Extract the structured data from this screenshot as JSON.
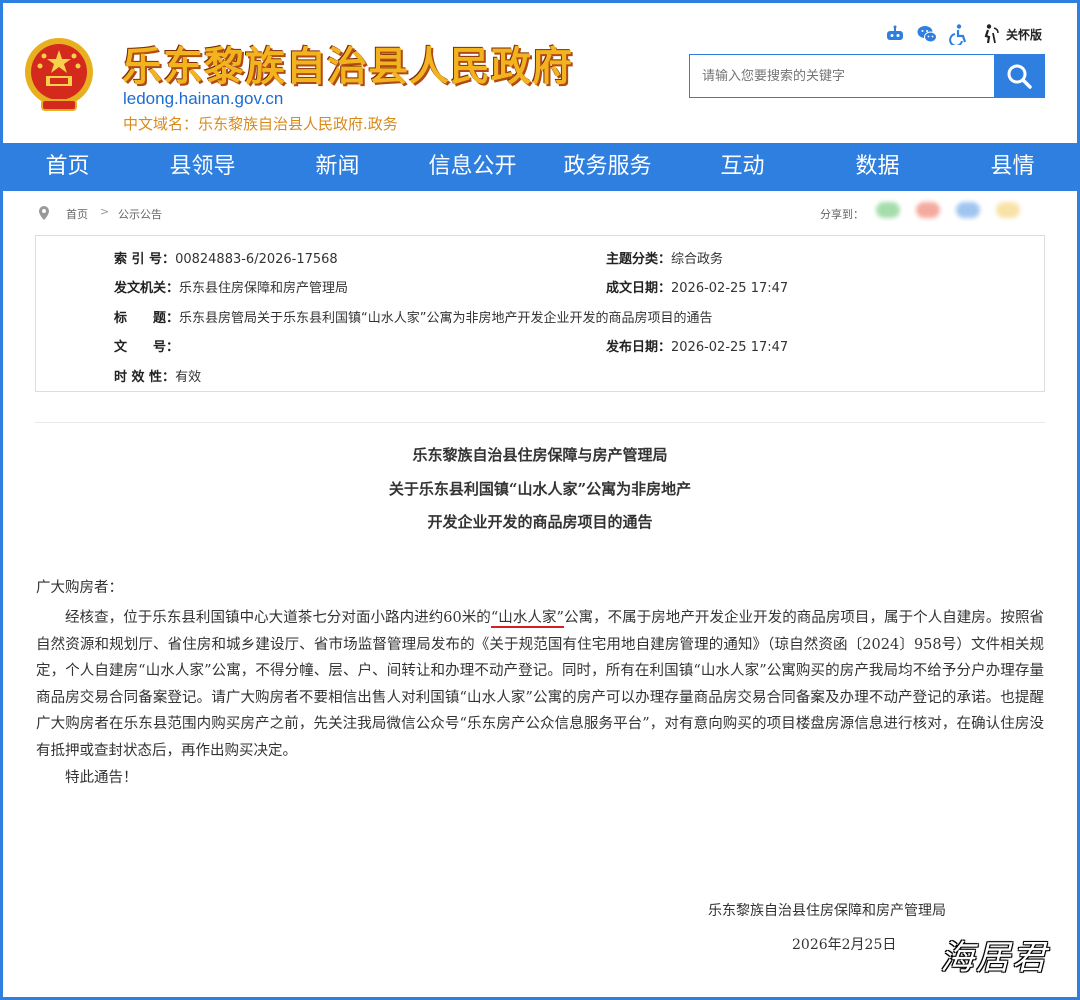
{
  "header": {
    "site_title": "乐东黎族自治县人民政府",
    "domain_en": "ledong.hainan.gov.cn",
    "domain_cn_label": "中文域名：",
    "domain_cn_value": "乐东黎族自治县人民政府.政务",
    "care_label": "关怀版",
    "search_placeholder": "请输入您要搜索的关键字",
    "icons": [
      "robot-icon",
      "wechat-icon",
      "accessibility-icon",
      "elderly-care-icon",
      "search-icon",
      "national-emblem-icon"
    ]
  },
  "nav": {
    "items": [
      "首页",
      "县领导",
      "新闻",
      "信息公开",
      "政务服务",
      "互动",
      "数据",
      "县情"
    ]
  },
  "breadcrumb": {
    "home": "首页",
    "separator": ">",
    "current": "公示公告",
    "share_label": "分享到："
  },
  "info": {
    "index_label": "索 引 号：",
    "index_value": "00824883-6/2026-17568",
    "topic_label": "主题分类：",
    "topic_value": "综合政务",
    "issuer_label": "发文机关：",
    "issuer_value": "乐东县住房保障和房产管理局",
    "date_created_label": "成文日期：",
    "date_created_value": "2026-02-25 17:47",
    "title_label": "标　　题：",
    "title_value": "乐东县房管局关于乐东县利国镇“山水人家”公寓为非房地产开发企业开发的商品房项目的通告",
    "docno_label": "文　　号：",
    "docno_value": "",
    "date_published_label": "发布日期：",
    "date_published_value": "2026-02-25 17:47",
    "validity_label": "时 效 性：",
    "validity_value": "有效"
  },
  "article": {
    "title_line1": "乐东黎族自治县住房保障与房产管理局",
    "title_line2": "关于乐东县利国镇“山水人家”公寓为非房地产",
    "title_line3": "开发企业开发的商品房项目的通告",
    "salutation": "广大购房者：",
    "para1_before": "经核查，位于乐东县利国镇中心大道茶七分对面小路内进约60米的",
    "para1_highlight": "“山水人家”",
    "para1_after": "公寓，不属于房地产开发企业开发的商品房项目，属于个人自建房。按照省自然资源和规划厅、省住房和城乡建设厅、省市场监督管理局发布的《关于规范国有住宅用地自建房管理的通知》（琼自然资函〔2024〕958号）文件相关规定，个人自建房“山水人家”公寓，不得分幢、层、户、间转让和办理不动产登记。同时，所有在利国镇“山水人家”公寓购买的房产我局均不给予分户办理存量商品房交易合同备案登记。请广大购房者不要相信出售人对利国镇“山水人家”公寓的房产可以办理存量商品房交易合同备案及办理不动产登记的承诺。也提醒广大购房者在乐东县范围内购买房产之前，先关注我局微信公众号“乐东房产公众信息服务平台”，对有意向购买的项目楼盘房源信息进行核对，在确认住房没有抵押或查封状态后，再作出购买决定。",
    "closing": "特此通告！",
    "signature": "乐东黎族自治县住房保障和房产管理局",
    "sign_date": "2026年2月25日"
  },
  "watermark": "海居君",
  "colors": {
    "primary": "#2f7fe0",
    "title_gold": "#f2b41e",
    "highlight_red": "#d12020"
  }
}
